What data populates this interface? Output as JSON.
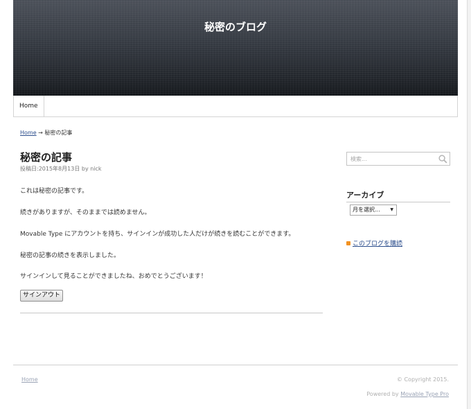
{
  "site": {
    "title": "秘密のブログ"
  },
  "nav": {
    "home_label": "Home"
  },
  "breadcrumb": {
    "home_label": "Home",
    "arrow": "→",
    "current": "秘密の記事"
  },
  "post": {
    "title": "秘密の記事",
    "meta": "投稿日:2015年8月13日 by nick",
    "paragraphs": [
      "これは秘密の記事です。",
      "続きがありますが、そのままでは読めません。",
      "Movable Type にアカウントを持ち、サインインが成功した人だけが続きを読むことができます。",
      "秘密の記事の続きを表示しました。",
      "サインインして見ることができましたね、おめでとうございます！"
    ],
    "signout_label": "サインアウト"
  },
  "sidebar": {
    "search_placeholder": "検索...",
    "archive_heading": "アーカイブ",
    "archive_select": "月を選択...",
    "subscribe_label": "このブログを購読"
  },
  "footer": {
    "home_label": "Home",
    "copyright": "© Copyright 2015.",
    "powered_prefix": "Powered by ",
    "powered_link": "Movable Type Pro"
  },
  "colors": {
    "link": "#2b4d8c",
    "feed": "#f29222",
    "header_dark": "#23272d"
  }
}
